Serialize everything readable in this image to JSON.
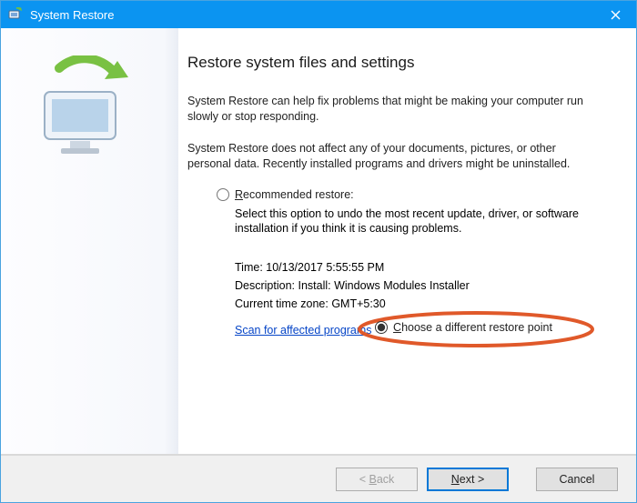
{
  "titlebar": {
    "title": "System Restore"
  },
  "heading": "Restore system files and settings",
  "intro1": "System Restore can help fix problems that might be making your computer run slowly or stop responding.",
  "intro2": "System Restore does not affect any of your documents, pictures, or other personal data. Recently installed programs and drivers might be uninstalled.",
  "options": {
    "recommended": {
      "label": "Recommended restore:",
      "mnemonic": "R",
      "desc": "Select this option to undo the most recent update, driver, or software installation if you think it is causing problems.",
      "time_label": "Time:",
      "time_value": "10/13/2017 5:55:55 PM",
      "description_label": "Description:",
      "description_value": "Install: Windows Modules Installer",
      "timezone_label": "Current time zone:",
      "timezone_value": "GMT+5:30"
    },
    "scan_link": "Scan for affected programs",
    "choose_different": {
      "label": "Choose a different restore point",
      "mnemonic": "C"
    }
  },
  "footer": {
    "back": "< Back",
    "next": "Next >",
    "cancel": "Cancel"
  }
}
